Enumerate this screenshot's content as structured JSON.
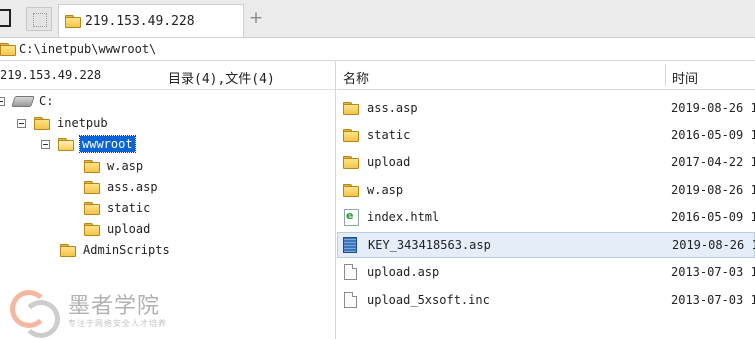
{
  "tabs": {
    "active_title": "219.153.49.228",
    "add_label": "+"
  },
  "path": {
    "value": "C:\\inetpub\\wwwroot\\"
  },
  "left": {
    "host": "219.153.49.228",
    "count": "目录(4),文件(4)",
    "tree": {
      "drive": "C:",
      "inetpub": "inetpub",
      "wwwroot": "wwwroot",
      "w_asp": "w.asp",
      "ass_asp": "ass.asp",
      "static": "static",
      "upload": "upload",
      "adminscripts": "AdminScripts"
    }
  },
  "right": {
    "col_name": "名称",
    "col_time": "时间",
    "files": [
      {
        "name": "ass.asp",
        "date": "2019-08-26 1",
        "type": "folder"
      },
      {
        "name": "static",
        "date": "2016-05-09 1",
        "type": "folder"
      },
      {
        "name": "upload",
        "date": "2017-04-22 1",
        "type": "folder"
      },
      {
        "name": "w.asp",
        "date": "2019-08-26 1",
        "type": "folder"
      },
      {
        "name": "index.html",
        "date": "2016-05-09 1",
        "type": "html"
      },
      {
        "name": "KEY_343418563.asp",
        "date": "2019-08-26 1",
        "type": "asp",
        "selected": true
      },
      {
        "name": "upload.asp",
        "date": "2013-07-03 1",
        "type": "file"
      },
      {
        "name": "upload_5xsoft.inc",
        "date": "2013-07-03 1",
        "type": "file"
      }
    ]
  },
  "watermark": {
    "brand": "墨者学院",
    "tagline": "专注于网络安全人才培养"
  }
}
